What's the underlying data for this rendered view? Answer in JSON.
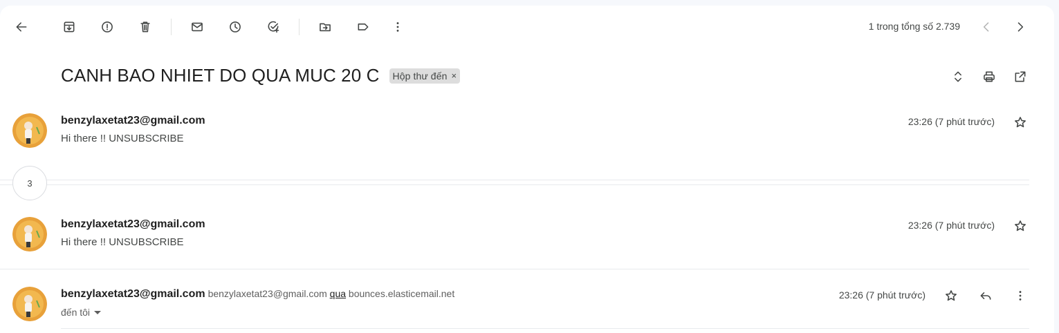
{
  "toolbar": {
    "back": "back-icon",
    "archive": "archive-icon",
    "spam": "report-spam-icon",
    "delete": "trash-icon",
    "mark_unread": "mail-icon",
    "snooze": "clock-icon",
    "add_task": "add-task-icon",
    "move": "move-to-icon",
    "label": "label-icon",
    "more": "more-vert-icon"
  },
  "pager": {
    "text": "1 trong tổng số 2.739"
  },
  "subject": {
    "title": "CANH BAO NHIET DO QUA MUC 20 C",
    "label": "Hộp thư đến",
    "label_remove": "×"
  },
  "thread": {
    "collapsed_count": "3",
    "messages": [
      {
        "sender": "benzylaxetat23@gmail.com",
        "snippet": "Hi there !! UNSUBSCRIBE",
        "time": "23:26 (7 phút trước)"
      },
      {
        "sender": "benzylaxetat23@gmail.com",
        "snippet": "Hi there !! UNSUBSCRIBE",
        "time": "23:26 (7 phút trước)"
      },
      {
        "sender": "benzylaxetat23@gmail.com",
        "sender_email": "benzylaxetat23@gmail.com",
        "via_word": "qua",
        "via_domain": "bounces.elasticemail.net",
        "to": "đến tôi",
        "time": "23:26 (7 phút trước)"
      }
    ]
  },
  "colors": {
    "background": "#f6f8fc",
    "panel": "#ffffff",
    "icon": "#444746",
    "avatar_bg": "#e8a13a"
  }
}
